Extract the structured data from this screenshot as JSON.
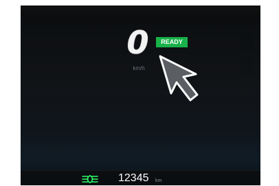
{
  "cluster": {
    "speed_value": "0",
    "speed_unit": "km/h",
    "ready_badge": "READY",
    "odometer_value": "12345",
    "odometer_unit": "km",
    "icons": {
      "ready_pointer": "arrow-pointer-icon",
      "headlights": "headlights-icon"
    },
    "colors": {
      "ready_badge": "#18b14a",
      "text_primary": "#ffffff",
      "text_muted": "#7f858b",
      "background": "#0b0d0f",
      "headlights_icon": "#2cff6a",
      "arrow_fill": "#5b5f63",
      "arrow_outline": "#ffffff"
    }
  }
}
